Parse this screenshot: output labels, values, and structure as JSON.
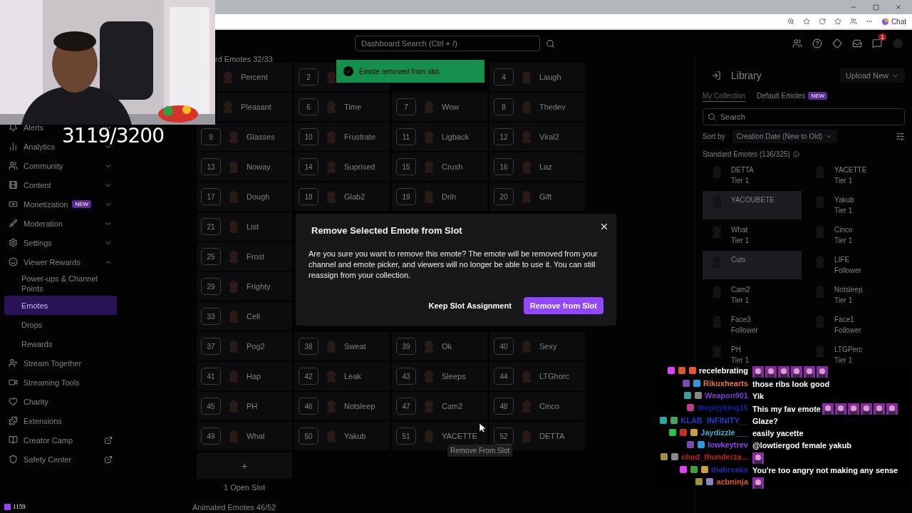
{
  "browser": {
    "chat_button": "Chat"
  },
  "overlay": {
    "counter": "3119/3200",
    "viewer_count": "1159"
  },
  "topbar": {
    "search": {
      "placeholder": "Dashboard Search (Ctrl + /)"
    },
    "notification_badge": "1"
  },
  "sidebar": {
    "items": [
      {
        "label": "Alerts",
        "kind": "section",
        "expanded": false
      },
      {
        "label": "Analytics",
        "kind": "section",
        "expanded": false
      },
      {
        "label": "Community",
        "kind": "section",
        "expanded": false
      },
      {
        "label": "Content",
        "kind": "section",
        "expanded": false
      },
      {
        "label": "Monetization",
        "kind": "section",
        "expanded": false,
        "badge": "NEW"
      },
      {
        "label": "Moderation",
        "kind": "section",
        "expanded": false
      },
      {
        "label": "Settings",
        "kind": "section",
        "expanded": false
      },
      {
        "label": "Viewer Rewards",
        "kind": "section",
        "expanded": true,
        "children": [
          {
            "label": "Power-ups & Channel Points",
            "selected": false
          },
          {
            "label": "Emotes",
            "selected": true
          },
          {
            "label": "Drops",
            "selected": false
          },
          {
            "label": "Rewards",
            "selected": false
          }
        ]
      },
      {
        "label": "Stream Together",
        "kind": "link"
      },
      {
        "label": "Streaming Tools",
        "kind": "link"
      },
      {
        "label": "Charity",
        "kind": "link"
      },
      {
        "label": "Extensions",
        "kind": "link"
      },
      {
        "label": "Creator Camp",
        "kind": "external"
      },
      {
        "label": "Safety Center",
        "kind": "external"
      }
    ]
  },
  "emotes": {
    "heading": "rd Emotes 32/33",
    "rows": [
      {
        "slots": [
          {
            "kind": "slot",
            "name": "Percent"
          },
          {
            "kind": "slot",
            "number": "2"
          },
          {
            "kind": "covered"
          },
          {
            "kind": "slot",
            "number": "4",
            "name": "Laugh"
          }
        ]
      },
      {
        "slots": [
          {
            "kind": "slot",
            "name": "Pleasant"
          },
          {
            "kind": "slot",
            "number": "6",
            "name": "Time"
          },
          {
            "kind": "slot",
            "number": "7",
            "name": "Wow"
          },
          {
            "kind": "slot",
            "number": "8",
            "name": "Thedev"
          }
        ]
      },
      {
        "slots": [
          {
            "kind": "slot",
            "number": "9",
            "name": "Glasses"
          },
          {
            "kind": "slot",
            "number": "10",
            "name": "Frustrate"
          },
          {
            "kind": "slot",
            "number": "11",
            "name": "Ligback"
          },
          {
            "kind": "slot",
            "number": "12",
            "name": "Viral2"
          }
        ]
      },
      {
        "slots": [
          {
            "kind": "slot",
            "number": "13",
            "name": "Noway"
          },
          {
            "kind": "slot",
            "number": "14",
            "name": "Suprised"
          },
          {
            "kind": "slot",
            "number": "15",
            "name": "Crush"
          },
          {
            "kind": "slot",
            "number": "16",
            "name": "Laz"
          }
        ]
      },
      {
        "slots": [
          {
            "kind": "slot",
            "number": "17",
            "name": "Dough"
          },
          {
            "kind": "slot",
            "number": "18",
            "name": "Glab2"
          },
          {
            "kind": "slot",
            "number": "19",
            "name": "Drih"
          },
          {
            "kind": "slot",
            "number": "20",
            "name": "Gift"
          }
        ]
      },
      {
        "slots": [
          {
            "kind": "slot",
            "number": "21",
            "name": "List"
          },
          {
            "kind": "covered"
          },
          {
            "kind": "covered"
          },
          {
            "kind": "covered"
          }
        ]
      },
      {
        "slots": [
          {
            "kind": "slot",
            "number": "25",
            "name": "Frost"
          },
          {
            "kind": "covered"
          },
          {
            "kind": "covered"
          },
          {
            "kind": "covered"
          }
        ]
      },
      {
        "slots": [
          {
            "kind": "slot",
            "number": "29",
            "name": "Frighty"
          },
          {
            "kind": "covered"
          },
          {
            "kind": "covered"
          },
          {
            "kind": "covered"
          }
        ]
      },
      {
        "slots": [
          {
            "kind": "slot",
            "number": "33",
            "name": "Cell"
          },
          {
            "kind": "covered"
          },
          {
            "kind": "covered"
          },
          {
            "kind": "covered"
          }
        ]
      },
      {
        "slots": [
          {
            "kind": "slot",
            "number": "37",
            "name": "Pog2"
          },
          {
            "kind": "slot",
            "number": "38",
            "name": "Sweat"
          },
          {
            "kind": "slot",
            "number": "39",
            "name": "Ok"
          },
          {
            "kind": "slot",
            "number": "40",
            "name": "Sexy"
          }
        ]
      },
      {
        "slots": [
          {
            "kind": "slot",
            "number": "41",
            "name": "Hap"
          },
          {
            "kind": "slot",
            "number": "42",
            "name": "Leak"
          },
          {
            "kind": "slot",
            "number": "43",
            "name": "Sleeps"
          },
          {
            "kind": "slot",
            "number": "44",
            "name": "LTGhorc"
          }
        ]
      },
      {
        "slots": [
          {
            "kind": "slot",
            "number": "45",
            "name": "PH"
          },
          {
            "kind": "slot",
            "number": "46",
            "name": "Notsleep"
          },
          {
            "kind": "slot",
            "number": "47",
            "name": "Cam2"
          },
          {
            "kind": "slot",
            "number": "48",
            "name": "Cinco"
          }
        ]
      },
      {
        "slots": [
          {
            "kind": "slot",
            "number": "49",
            "name": "What"
          },
          {
            "kind": "slot",
            "number": "50",
            "name": "Yakub"
          },
          {
            "kind": "slot",
            "number": "51",
            "name": "YACETTE"
          },
          {
            "kind": "slot",
            "number": "52",
            "name": "DETTA"
          }
        ]
      }
    ],
    "add_slot": "+",
    "open_slots": "1 Open Slot",
    "animated_heading": "Animated Emotes 46/52"
  },
  "toast": {
    "message": "Emote removed from slot."
  },
  "tooltip": {
    "text": "Remove From Slot"
  },
  "library": {
    "title": "Library",
    "upload_button": "Upload New",
    "tabs": [
      {
        "label": "My Collection",
        "selected": true
      },
      {
        "label": "Default Emotes",
        "selected": false,
        "badge": "NEW"
      }
    ],
    "search": {
      "placeholder": "Search"
    },
    "sort_label": "Sort by",
    "sort_value": "Creation Date (New to Old)",
    "section": "Standard Emotes (136/325)",
    "items": [
      {
        "name": "DETTA",
        "tier": "Tier 1",
        "selected": false
      },
      {
        "name": "YACETTE",
        "tier": "Tier 1",
        "selected": false
      },
      {
        "name": "YACOUBETE",
        "selected": true
      },
      {
        "name": "Yakub",
        "tier": "Tier 1",
        "selected": false
      },
      {
        "name": "What",
        "tier": "Tier 1",
        "selected": false
      },
      {
        "name": "Cinco",
        "tier": "Tier 1",
        "selected": false
      },
      {
        "name": "Cuts",
        "selected": true
      },
      {
        "name": "LIFE",
        "tier": "Follower",
        "selected": false
      },
      {
        "name": "Cam2",
        "tier": "Tier 1",
        "selected": false
      },
      {
        "name": "Notsleep",
        "tier": "Tier 1",
        "selected": false
      },
      {
        "name": "Face3",
        "tier": "Follower",
        "selected": false
      },
      {
        "name": "Face1",
        "tier": "Follower",
        "selected": false
      },
      {
        "name": "PH",
        "tier": "Tier 1",
        "selected": false
      },
      {
        "name": "LTGPerc",
        "tier": "Tier 1",
        "selected": false
      }
    ]
  },
  "dialog": {
    "title": "Remove Selected Emote from Slot",
    "body": "Are you sure you want to remove this emote? The emote will be removed from your channel and emote picker, and viewers will no longer be able to use it. You can still reassign from your collection.",
    "buttons": [
      {
        "label": "Keep Slot Assignment",
        "kind": "secondary"
      },
      {
        "label": "Remove from Slot",
        "kind": "primary"
      }
    ]
  },
  "chat": [
    {
      "user": "recelebrating",
      "color": "#ffffff",
      "badges": [
        {
          "color": "#e040fb"
        },
        {
          "color": "#e5562e"
        },
        {
          "color": "#e5562e"
        }
      ],
      "emotes": [
        {
          "kind": "picture"
        },
        {
          "kind": "picture"
        },
        {
          "kind": "picture"
        },
        {
          "kind": "picture"
        },
        {
          "kind": "picture"
        },
        {
          "kind": "picture"
        }
      ]
    },
    {
      "user": "Rikuxhearts",
      "color": "#e8734a",
      "badges": [
        {
          "color": "#7b4bb5"
        },
        {
          "color": "#2d9be0"
        }
      ],
      "message": "those ribs look good"
    },
    {
      "user": "Weapon901",
      "color": "#7c3ad8",
      "badges": [
        {
          "color": "#3aa0a0"
        },
        {
          "color": "#888888"
        }
      ],
      "message": "Yik"
    },
    {
      "user": "theprjyking15",
      "color": "#1a1aa8",
      "badges": [
        {
          "color": "#c23a8a"
        }
      ],
      "message": "This my fav emote",
      "emotes": [
        {
          "kind": "picture"
        },
        {
          "kind": "picture"
        },
        {
          "kind": "picture"
        },
        {
          "kind": "picture"
        },
        {
          "kind": "picture"
        },
        {
          "kind": "picture"
        }
      ]
    },
    {
      "user": "KLAB_INFINITY__",
      "color": "#1f3fcf",
      "badges": [
        {
          "color": "#2aa8a8"
        },
        {
          "color": "#3aa860"
        }
      ],
      "message": "Glaze?"
    },
    {
      "user": "Jaydizzle___",
      "color": "#2fb2c9",
      "badges": [
        {
          "color": "#2ec04a"
        },
        {
          "color": "#c8301e"
        },
        {
          "color": "#c8a040"
        }
      ],
      "message": "easily yacette"
    },
    {
      "user": "lowkeytrev",
      "color": "#8a45e6",
      "badges": [
        {
          "color": "#7b4bb5"
        },
        {
          "color": "#2d9be0"
        }
      ],
      "message": "@lowtiergod female yakub"
    },
    {
      "user": "chad_thunderza...",
      "color": "#c81e1e",
      "badges": [
        {
          "color": "#a09040"
        },
        {
          "color": "#888888"
        }
      ],
      "emotes": [
        {
          "kind": "picture"
        }
      ]
    },
    {
      "user": "thabreaks",
      "color": "#2424b0",
      "badges": [
        {
          "color": "#e040fb"
        },
        {
          "color": "#40a040"
        },
        {
          "color": "#c8a040"
        }
      ],
      "message": "You're too angry not making any sense"
    },
    {
      "user": "acbninja",
      "color": "#e05a1a",
      "badges": [
        {
          "color": "#a09040"
        },
        {
          "color": "#8888c8"
        }
      ],
      "emotes": [
        {
          "kind": "picture"
        }
      ]
    }
  ]
}
